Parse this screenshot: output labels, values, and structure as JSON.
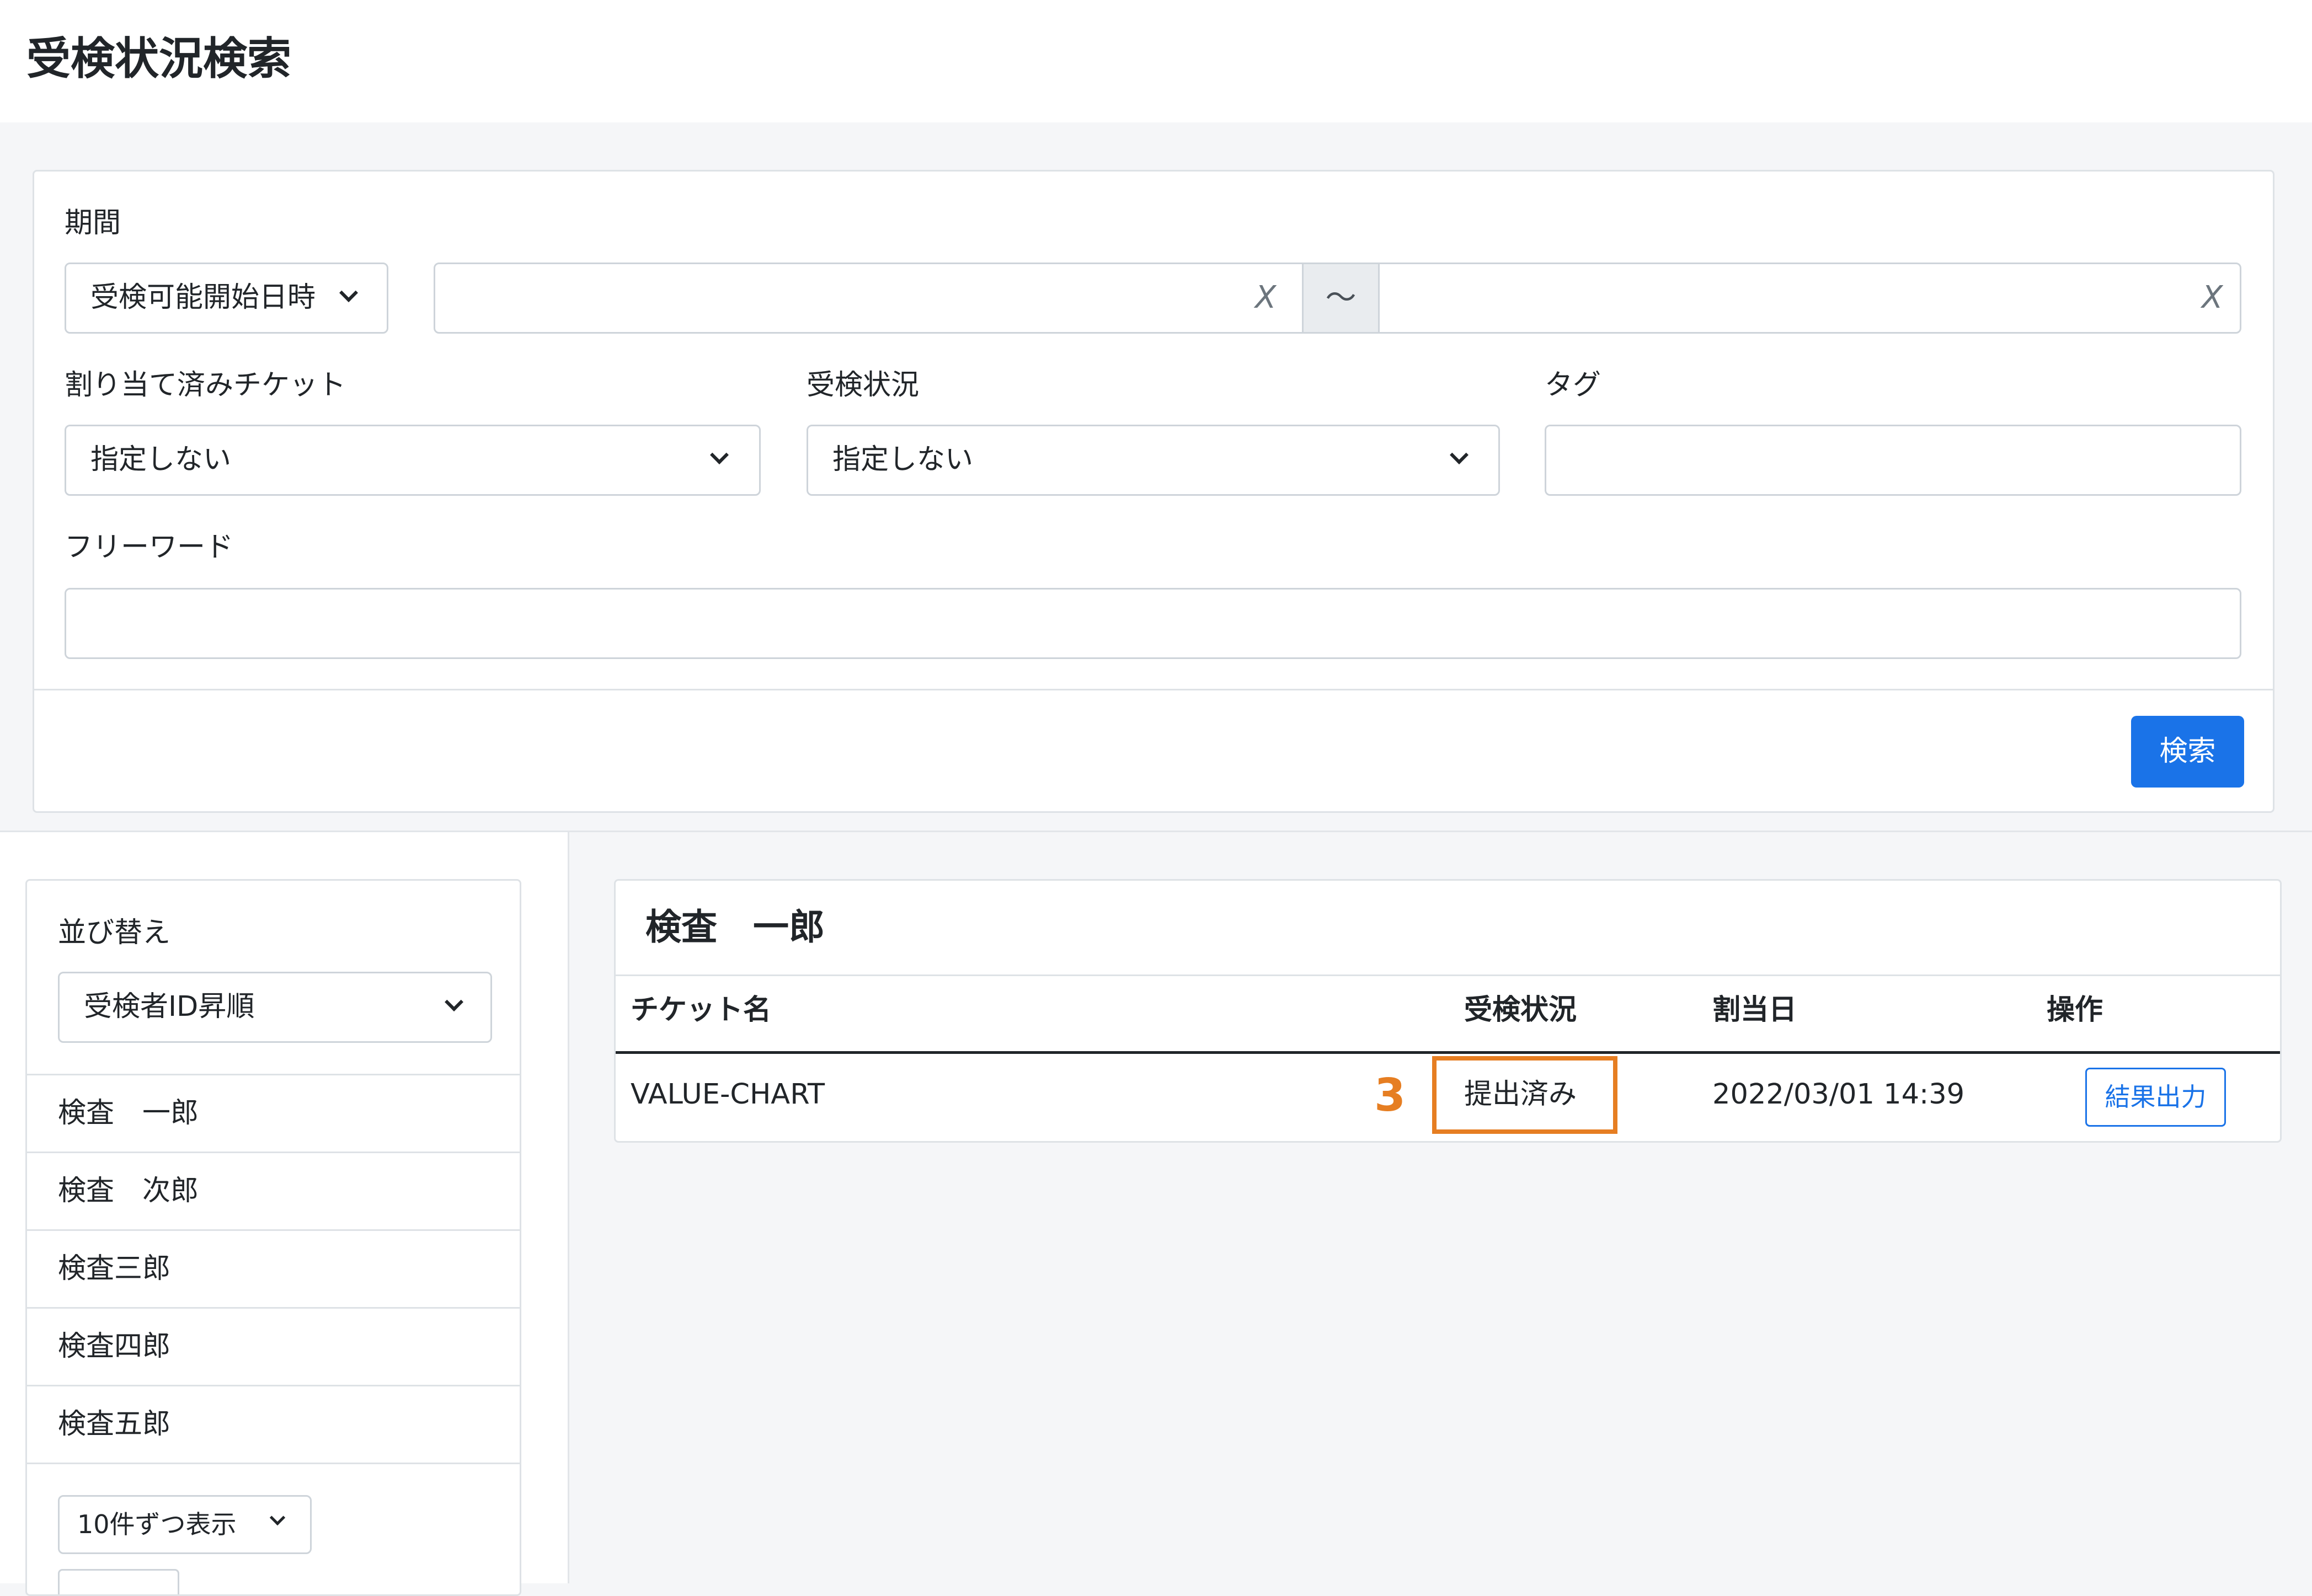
{
  "page": {
    "title": "受検状況検索"
  },
  "search": {
    "period_label": "期間",
    "period_type_selected": "受検可能開始日時",
    "date_range_separator": "〜",
    "clear_glyph": "X",
    "assigned_ticket_label": "割り当て済みチケット",
    "assigned_ticket_selected": "指定しない",
    "status_label": "受検状況",
    "status_selected": "指定しない",
    "tag_label": "タグ",
    "freeword_label": "フリーワード",
    "search_button": "検索"
  },
  "sidebar": {
    "sort_label": "並び替え",
    "sort_selected": "受検者ID昇順",
    "people": [
      "検査　一郎",
      "検査　次郎",
      "検査三郎",
      "検査四郎",
      "検査五郎"
    ],
    "page_size_selected": "10件ずつ表示"
  },
  "result": {
    "person_name": "検査　一郎",
    "columns": [
      "チケット名",
      "受検状況",
      "割当日",
      "操作"
    ],
    "rows": [
      {
        "ticket": "VALUE-CHART",
        "status": "提出済み",
        "assigned": "2022/03/01 14:39",
        "action": "結果出力"
      }
    ],
    "callout_number": "3"
  },
  "colors": {
    "primary": "#1a73e8",
    "highlight": "#e67e22"
  }
}
